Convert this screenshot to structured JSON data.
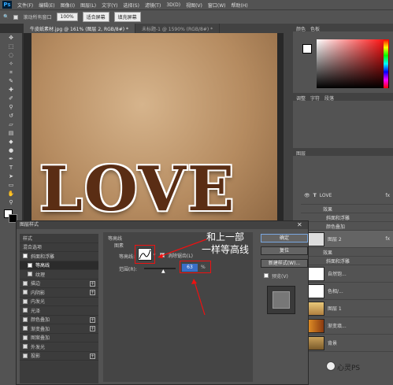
{
  "app": {
    "logo": "Ps"
  },
  "menubar": [
    "文件(F)",
    "编辑(E)",
    "图像(I)",
    "图层(L)",
    "文字(Y)",
    "选择(S)",
    "滤镜(T)",
    "3D(D)",
    "视图(V)",
    "窗口(W)",
    "帮助(H)"
  ],
  "options": {
    "scroll_all": "滚动所有窗口",
    "zoom": "100%",
    "fit": "适合屏幕",
    "fill": "填充屏幕"
  },
  "tabs": [
    "牛皮纸素材.jpg @ 161% (图层 2, RGB/8#) *",
    "未标题-1 @ 1590% (RGB/8#) *"
  ],
  "canvas": {
    "text": "LOVE"
  },
  "panels": {
    "color_tabs": [
      "颜色",
      "色板"
    ],
    "adjust_tabs": [
      "调整",
      "字符",
      "段落"
    ],
    "layers_tab": "图层",
    "layers": [
      {
        "name": "LOVE",
        "fx": "fx"
      },
      {
        "name": "效果",
        "fx": ""
      },
      {
        "name": "斜面和浮雕",
        "fx": ""
      },
      {
        "name": "颜色叠加",
        "fx": ""
      },
      {
        "name": "图层 2",
        "fx": "fx"
      },
      {
        "name": "效果",
        "fx": ""
      },
      {
        "name": "斜面和浮雕",
        "fx": ""
      },
      {
        "name": "自然饱...",
        "fx": ""
      },
      {
        "name": "色相/...",
        "fx": ""
      },
      {
        "name": "图层 1",
        "fx": ""
      },
      {
        "name": "渐变填...",
        "fx": ""
      },
      {
        "name": "背景",
        "fx": ""
      }
    ]
  },
  "dialog": {
    "title": "图层样式",
    "styles_header": "样式",
    "blend": "混合选项",
    "items": [
      "斜面和浮雕",
      "等高线",
      "纹理",
      "描边",
      "内阴影",
      "内发光",
      "光泽",
      "颜色叠加",
      "渐变叠加",
      "图案叠加",
      "外发光",
      "投影"
    ],
    "section_title": "等高线",
    "section_sub": "图素",
    "contour_label": "等高线:",
    "antialias": "消除锯齿(L)",
    "range_label": "范围(R):",
    "range_value": "63",
    "range_unit": "%",
    "ok": "确定",
    "reset": "复位",
    "new_style": "新建样式(W)...",
    "preview": "预览(V)"
  },
  "annotation": {
    "line1": "和上一部",
    "line2": "一样等高线"
  },
  "watermark": "心灵PS"
}
